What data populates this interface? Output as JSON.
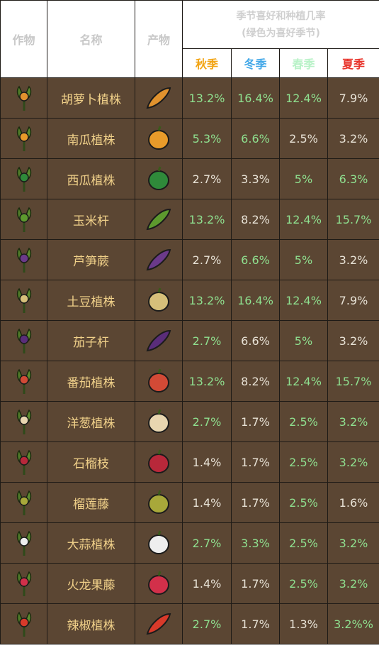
{
  "colors": {
    "header_bg": "#ffffff",
    "row_bg": "#5b4633",
    "name_text": "#f1d18a",
    "favored_value": "#8fe08f",
    "normal_value": "#e8e2d6",
    "autumn": "#f2a516",
    "winter": "#43a8e8",
    "spring": "#b9f2c8",
    "summer": "#e8342b"
  },
  "header": {
    "col_crop": "作物",
    "col_name": "名称",
    "col_product": "产物",
    "title_line1": "季节喜好和种植几率",
    "title_line2": "(绿色为喜好季节)",
    "seasons": [
      {
        "label": "秋季",
        "color": "#f2a516"
      },
      {
        "label": "冬季",
        "color": "#43a8e8"
      },
      {
        "label": "春季",
        "color": "#b9f2c8"
      },
      {
        "label": "夏季",
        "color": "#e8342b"
      }
    ]
  },
  "rows": [
    {
      "name": "胡萝卜植株",
      "crop_icon": "carrot-plant-icon",
      "product_icon": "carrot-icon",
      "values": [
        "13.2%",
        "16.4%",
        "12.4%",
        "7.9%"
      ],
      "favored": [
        true,
        true,
        true,
        false
      ]
    },
    {
      "name": "南瓜植株",
      "crop_icon": "pumpkin-plant-icon",
      "product_icon": "pumpkin-icon",
      "values": [
        "5.3%",
        "6.6%",
        "2.5%",
        "3.2%"
      ],
      "favored": [
        true,
        true,
        false,
        false
      ]
    },
    {
      "name": "西瓜植株",
      "crop_icon": "watermelon-plant-icon",
      "product_icon": "watermelon-icon",
      "values": [
        "2.7%",
        "3.3%",
        "5%",
        "6.3%"
      ],
      "favored": [
        false,
        false,
        true,
        true
      ]
    },
    {
      "name": "玉米杆",
      "crop_icon": "corn-plant-icon",
      "product_icon": "corn-icon",
      "values": [
        "13.2%",
        "8.2%",
        "12.4%",
        "15.7%"
      ],
      "favored": [
        true,
        false,
        true,
        true
      ]
    },
    {
      "name": "芦笋蕨",
      "crop_icon": "asparagus-plant-icon",
      "product_icon": "asparagus-icon",
      "values": [
        "2.7%",
        "6.6%",
        "5%",
        "3.2%"
      ],
      "favored": [
        false,
        true,
        true,
        false
      ]
    },
    {
      "name": "土豆植株",
      "crop_icon": "potato-plant-icon",
      "product_icon": "potato-icon",
      "values": [
        "13.2%",
        "16.4%",
        "12.4%",
        "7.9%"
      ],
      "favored": [
        true,
        true,
        true,
        false
      ]
    },
    {
      "name": "茄子杆",
      "crop_icon": "eggplant-plant-icon",
      "product_icon": "eggplant-icon",
      "values": [
        "2.7%",
        "6.6%",
        "5%",
        "3.2%"
      ],
      "favored": [
        true,
        false,
        true,
        false
      ]
    },
    {
      "name": "番茄植株",
      "crop_icon": "tomato-plant-icon",
      "product_icon": "tomato-icon",
      "values": [
        "13.2%",
        "8.2%",
        "12.4%",
        "15.7%"
      ],
      "favored": [
        true,
        false,
        true,
        true
      ]
    },
    {
      "name": "洋葱植株",
      "crop_icon": "onion-plant-icon",
      "product_icon": "onion-icon",
      "values": [
        "2.7%",
        "1.7%",
        "2.5%",
        "3.2%"
      ],
      "favored": [
        true,
        false,
        true,
        true
      ]
    },
    {
      "name": "石榴枝",
      "crop_icon": "pomegranate-plant-icon",
      "product_icon": "pomegranate-icon",
      "values": [
        "1.4%",
        "1.7%",
        "2.5%",
        "3.2%"
      ],
      "favored": [
        false,
        false,
        true,
        true
      ]
    },
    {
      "name": "榴莲藤",
      "crop_icon": "durian-plant-icon",
      "product_icon": "durian-icon",
      "values": [
        "1.4%",
        "1.7%",
        "2.5%",
        "1.6%"
      ],
      "favored": [
        false,
        false,
        true,
        false
      ]
    },
    {
      "name": "大蒜植株",
      "crop_icon": "garlic-plant-icon",
      "product_icon": "garlic-icon",
      "values": [
        "2.7%",
        "3.3%",
        "2.5%",
        "3.2%"
      ],
      "favored": [
        true,
        true,
        true,
        true
      ]
    },
    {
      "name": "火龙果藤",
      "crop_icon": "dragonfruit-plant-icon",
      "product_icon": "dragonfruit-icon",
      "values": [
        "1.4%",
        "1.7%",
        "2.5%",
        "3.2%"
      ],
      "favored": [
        false,
        false,
        true,
        true
      ]
    },
    {
      "name": "辣椒植株",
      "crop_icon": "pepper-plant-icon",
      "product_icon": "pepper-icon",
      "values": [
        "2.7%",
        "1.7%",
        "1.3%",
        "3.2%%"
      ],
      "favored": [
        true,
        false,
        false,
        true
      ]
    }
  ]
}
